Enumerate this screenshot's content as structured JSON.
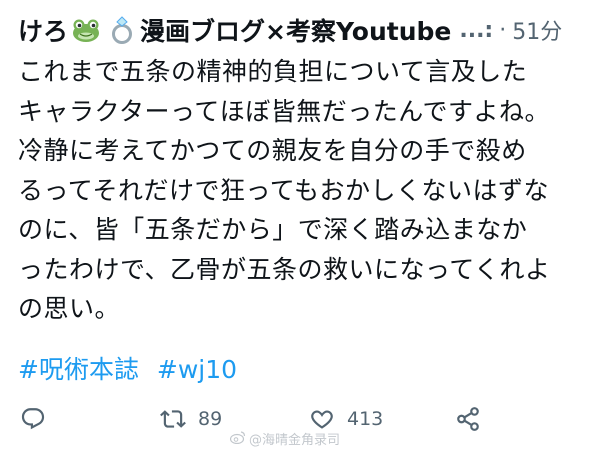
{
  "tweet": {
    "author_prefix": "けろ",
    "author_suffix": "漫画ブログ×考察Youtube",
    "emoji_1": "frog-face-emoji",
    "emoji_2": "ring-emoji",
    "truncation": "...:",
    "separator": "·",
    "timestamp": "51分",
    "body_lines": [
      "これまで五条の精神的負担について言及した",
      "キャラクターってほぼ皆無だったんですよね。",
      "冷静に考えてかつての親友を自分の手で殺め",
      "るってそれだけで狂ってもおかしくないはずな",
      "のに、皆「五条だから」で深く踏み込まなか",
      "ったわけで、乙骨が五条の救いになってくれよ",
      "の思い。"
    ],
    "hashtags": [
      "#呪術本誌",
      "#wj10"
    ]
  },
  "actions": {
    "reply_icon": "reply-icon",
    "retweet_icon": "retweet-icon",
    "retweet_count": "89",
    "like_icon": "heart-icon",
    "like_count": "413",
    "share_icon": "share-icon"
  },
  "watermark": {
    "text": "@海晴金角录司"
  },
  "colors": {
    "text": "#0f1419",
    "secondary": "#536471",
    "link": "#1d9bf0",
    "background": "#ffffff"
  }
}
